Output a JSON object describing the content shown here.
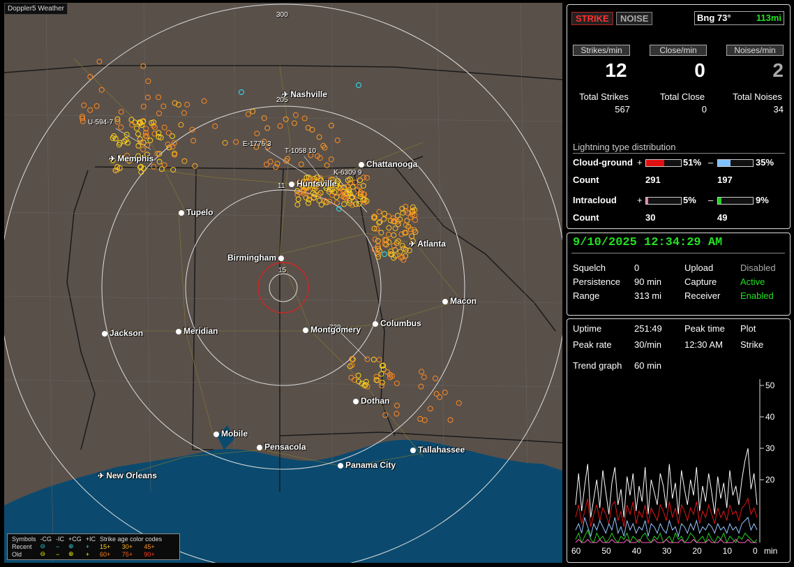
{
  "window_title": "Doppler5 Weather",
  "map": {
    "range_rings": [
      "300",
      "205",
      "15"
    ],
    "cities": [
      {
        "name": "Nashville",
        "icon": "airport-icon"
      },
      {
        "name": "Memphis",
        "icon": "airport-icon"
      },
      {
        "name": "Chattanooga",
        "icon": "city-dot"
      },
      {
        "name": "Huntsville",
        "icon": "city-dot"
      },
      {
        "name": "Tupelo",
        "icon": "city-dot"
      },
      {
        "name": "Atlanta",
        "icon": "airport-icon"
      },
      {
        "name": "Birmingham",
        "icon": "city-dot"
      },
      {
        "name": "Macon",
        "icon": "city-dot"
      },
      {
        "name": "Jackson",
        "icon": "city-dot"
      },
      {
        "name": "Meridian",
        "icon": "city-dot"
      },
      {
        "name": "Montgomery",
        "icon": "city-dot"
      },
      {
        "name": "Columbus",
        "icon": "city-dot"
      },
      {
        "name": "Dothan",
        "icon": "city-dot"
      },
      {
        "name": "Mobile",
        "icon": "city-dot"
      },
      {
        "name": "Pensacola",
        "icon": "city-dot"
      },
      {
        "name": "Tallahassee",
        "icon": "city-dot"
      },
      {
        "name": "Panama City",
        "icon": "city-dot"
      },
      {
        "name": "New Orleans",
        "icon": "airport-icon"
      }
    ],
    "storm_tags": [
      "U-594-7",
      "E-1776 3",
      "T-1058 10",
      "K-6309 9",
      "11",
      "729"
    ],
    "legend": {
      "header": [
        "Symbols",
        "-CG",
        "-IC",
        "+CG",
        "+IC",
        "Strike age color codes"
      ],
      "recent": {
        "label": "Recent",
        "ages": [
          "15+",
          "30+",
          "45+"
        ]
      },
      "old": {
        "label": "Old",
        "ages": [
          "60+",
          "75+",
          "90+"
        ]
      }
    }
  },
  "top": {
    "strike_btn": "STRIKE",
    "noise_btn": "NOISE",
    "bearing": "Bng 73°",
    "distance": "113mi",
    "headers": [
      "Strikes/min",
      "Close/min",
      "Noises/min"
    ],
    "rates": [
      "12",
      "0",
      "2"
    ],
    "totals_labels": [
      "Total Strikes",
      "Total Close",
      "Total Noises"
    ],
    "totals": [
      "567",
      "0",
      "34"
    ],
    "dist_title": "Lightning type distribution",
    "cloud_ground": {
      "label": "Cloud-ground",
      "pos_pct": "51%",
      "neg_pct": "35%",
      "pos_count": "291",
      "neg_count": "197",
      "pos_frac": 0.51,
      "neg_frac": 0.35
    },
    "intracloud": {
      "label": "Intracloud",
      "pos_pct": "5%",
      "neg_pct": "9%",
      "pos_count": "30",
      "neg_count": "49",
      "pos_frac": 0.05,
      "neg_frac": 0.09
    },
    "count_label": "Count",
    "plus": "+",
    "minus": "–"
  },
  "status": {
    "datetime": "9/10/2025 12:34:29 AM",
    "rows": [
      {
        "k": "Squelch",
        "v": "0",
        "k2": "Upload",
        "v2": "Disabled"
      },
      {
        "k": "Persistence",
        "v": "90 min",
        "k2": "Capture",
        "v2": "Active"
      },
      {
        "k": "Range",
        "v": "313 mi",
        "k2": "Receiver",
        "v2": "Enabled"
      }
    ]
  },
  "stats": {
    "uptime_label": "Uptime",
    "uptime": "251:49",
    "peak_time_label": "Peak time",
    "plot_label": "Plot",
    "peak_rate_label": "Peak rate",
    "peak_rate": "30/min",
    "peak_time": "12:30 AM",
    "plot": "Strike",
    "trend_label": "Trend graph",
    "trend": "60 min"
  },
  "chart_data": {
    "type": "line",
    "x_ticks": [
      "60",
      "50",
      "40",
      "30",
      "20",
      "10",
      "0",
      "min"
    ],
    "y_ticks": [
      "50",
      "40",
      "30",
      "20"
    ],
    "ylim": [
      0,
      52
    ],
    "x": [
      60,
      59,
      58,
      57,
      56,
      55,
      54,
      53,
      52,
      51,
      50,
      49,
      48,
      47,
      46,
      45,
      44,
      43,
      42,
      41,
      40,
      39,
      38,
      37,
      36,
      35,
      34,
      33,
      32,
      31,
      30,
      29,
      28,
      27,
      26,
      25,
      24,
      23,
      22,
      21,
      20,
      19,
      18,
      17,
      16,
      15,
      14,
      13,
      12,
      11,
      10,
      9,
      8,
      7,
      6,
      5,
      4,
      3,
      2,
      1,
      0
    ],
    "series": [
      {
        "color": "#ffffff",
        "values": [
          12,
          22,
          10,
          18,
          25,
          8,
          14,
          20,
          11,
          23,
          16,
          9,
          19,
          24,
          12,
          17,
          8,
          21,
          15,
          22,
          10,
          18,
          13,
          24,
          9,
          20,
          16,
          12,
          22,
          18,
          11,
          25,
          14,
          19,
          9,
          23,
          17,
          12,
          20,
          15,
          24,
          10,
          18,
          13,
          22,
          16,
          9,
          21,
          14,
          19,
          11,
          23,
          15,
          18,
          12,
          20,
          26,
          30,
          17,
          22,
          12
        ]
      },
      {
        "color": "#e01818",
        "values": [
          8,
          12,
          6,
          10,
          14,
          5,
          9,
          12,
          7,
          11,
          9,
          6,
          12,
          13,
          7,
          10,
          5,
          12,
          9,
          13,
          6,
          10,
          8,
          12,
          6,
          11,
          9,
          7,
          12,
          10,
          7,
          13,
          8,
          11,
          6,
          12,
          10,
          7,
          11,
          9,
          13,
          6,
          10,
          8,
          12,
          9,
          6,
          11,
          8,
          10,
          7,
          12,
          9,
          10,
          7,
          11,
          12,
          14,
          9,
          11,
          8
        ]
      },
      {
        "color": "#9ac6ff",
        "values": [
          4,
          6,
          3,
          8,
          5,
          2,
          6,
          4,
          7,
          5,
          3,
          6,
          4,
          8,
          3,
          5,
          2,
          7,
          4,
          6,
          3,
          5,
          4,
          7,
          2,
          6,
          5,
          3,
          6,
          4,
          3,
          7,
          4,
          5,
          2,
          6,
          5,
          3,
          6,
          4,
          7,
          3,
          5,
          4,
          6,
          5,
          3,
          6,
          4,
          5,
          3,
          6,
          4,
          5,
          3,
          6,
          7,
          8,
          4,
          6,
          4
        ]
      },
      {
        "color": "#22d022",
        "values": [
          1,
          3,
          0,
          2,
          4,
          1,
          0,
          3,
          1,
          2,
          0,
          1,
          3,
          1,
          0,
          2,
          1,
          3,
          0,
          2,
          1,
          0,
          2,
          3,
          1,
          0,
          2,
          1,
          3,
          0,
          1,
          2,
          0,
          3,
          1,
          2,
          0,
          1,
          3,
          2,
          0,
          1,
          2,
          0,
          3,
          1,
          0,
          2,
          1,
          3,
          0,
          2,
          1,
          0,
          2,
          1,
          3,
          2,
          1,
          0,
          1
        ]
      },
      {
        "color": "#ff60c0",
        "values": [
          0,
          1,
          0,
          0,
          1,
          0,
          0,
          0,
          1,
          0,
          0,
          0,
          1,
          0,
          0,
          0,
          0,
          1,
          0,
          0,
          0,
          1,
          0,
          0,
          0,
          0,
          1,
          0,
          0,
          0,
          1,
          0,
          0,
          0,
          0,
          1,
          0,
          0,
          0,
          1,
          0,
          0,
          0,
          0,
          1,
          0,
          0,
          0,
          1,
          0,
          0,
          0,
          0,
          1,
          0,
          0,
          0,
          1,
          0,
          0,
          0
        ]
      }
    ]
  }
}
